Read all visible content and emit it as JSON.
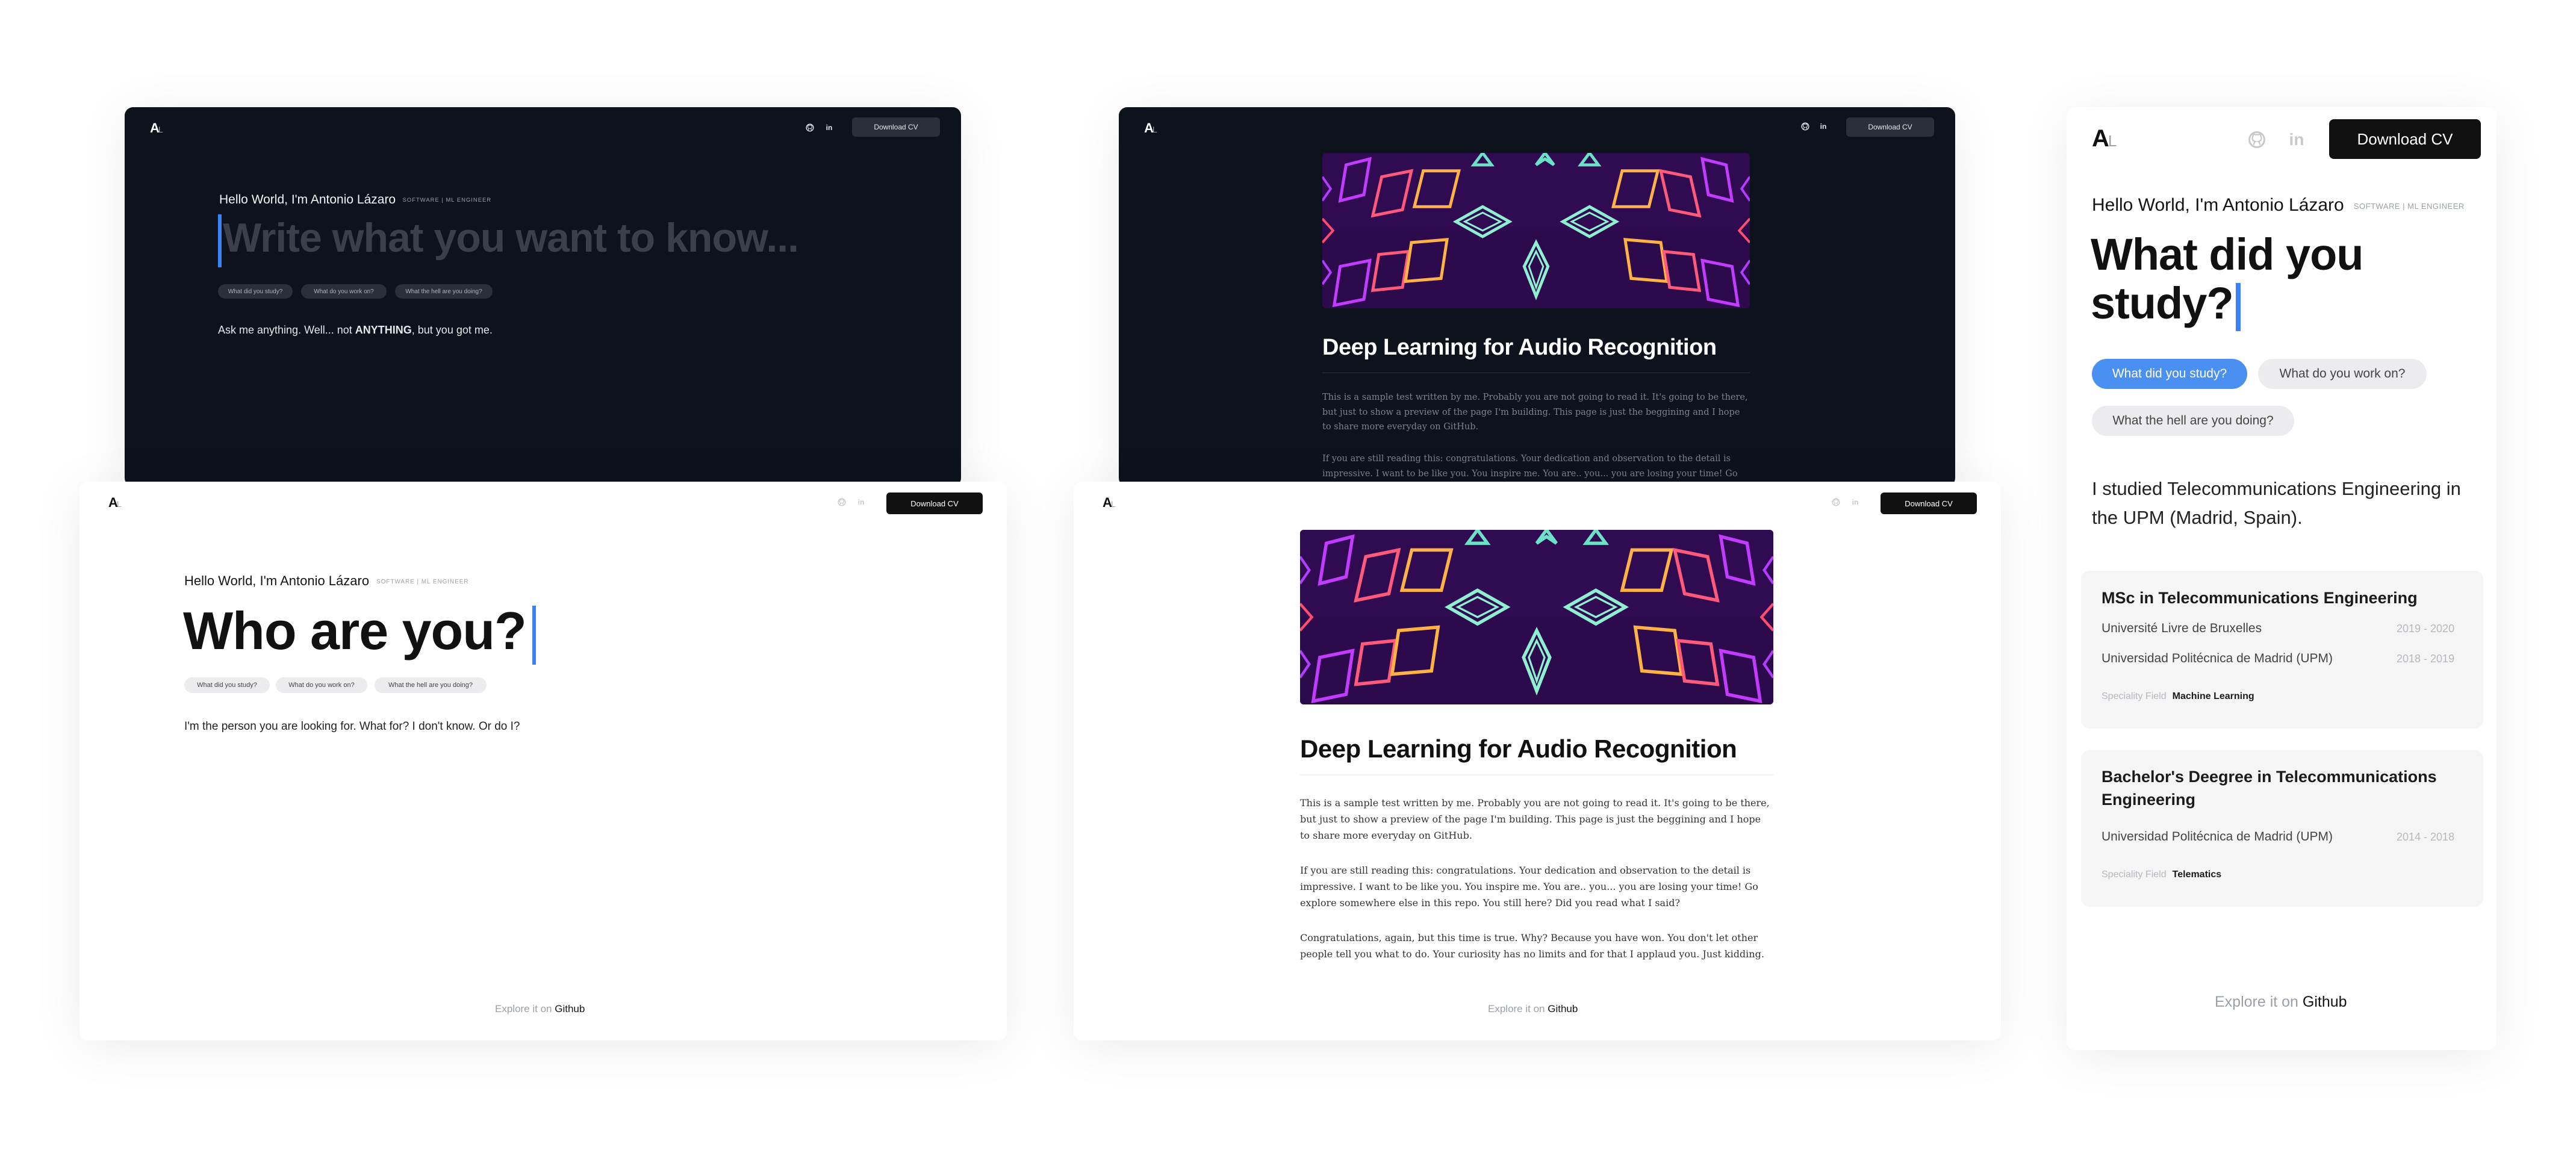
{
  "header": {
    "logo_a": "A",
    "logo_l": "L",
    "download_cv": "Download CV",
    "github_icon": "github-icon",
    "linkedin_icon": "linkedin-icon",
    "linkedin_label": "in"
  },
  "intro": {
    "hello": "Hello World, I'm",
    "name": "Antonio Lázaro",
    "role": "SOFTWARE | ML ENGINEER"
  },
  "questions": {
    "q1": "What did you study?",
    "q2": "What do you work on?",
    "q3": "What the hell are you doing?"
  },
  "screen1": {
    "placeholder": "Write what you want to know...",
    "answer_pre": "Ask me anything. Well... not ",
    "answer_strong": "ANYTHING",
    "answer_post": ", but you got me."
  },
  "screen2": {
    "headline": "Who are you?",
    "answer": "I'm the person you are looking for. What for? I don't know. Or do I?"
  },
  "article": {
    "title": "Deep Learning for Audio Recognition",
    "p1": "This is a sample test written by me. Probably you are not going to read it. It's going to be there, but just to show a preview of the page I'm building. This page is just the beggining and I hope to share more everyday on GitHub.",
    "p2": "If you are still reading this: congratulations. Your dedication and observation to the detail is impressive. I want to be like you. You inspire me. You are.. you... you are losing your time! Go explore somewhere else in this repo. You still here? Did you read what I said?",
    "p3": "Congratulations, again, but this time is true. Why? Because you have won. You don't let other people tell you what to do. Your curiosity has no limits and for that I applaud you. Just kidding."
  },
  "mobile": {
    "headline_line1": "What did you",
    "headline_line2": "study?",
    "answer": "I studied Telecommunications Engineering in the UPM (Madrid, Spain).",
    "edu": [
      {
        "degree": "MSc in Telecommunications Engineering",
        "schools": [
          {
            "name": "Université Livre de Bruxelles",
            "years": "2019 - 2020"
          },
          {
            "name": "Universidad Politécnica de Madrid (UPM)",
            "years": "2018 - 2019"
          }
        ],
        "field_label": "Speciality Field",
        "field": "Machine Learning"
      },
      {
        "degree": "Bachelor's Deegree in Telecommunications Engineering",
        "schools": [
          {
            "name": "Universidad Politécnica de Madrid (UPM)",
            "years": "2014 - 2018"
          }
        ],
        "field_label": "Speciality Field",
        "field": "Telematics"
      }
    ]
  },
  "footer": {
    "explore": "Explore it on",
    "github": "Github"
  },
  "colors": {
    "dark_bg": "#0e121c",
    "accent_blue": "#3b82f6",
    "chip_blue": "#4a90f0",
    "banner_purple": "#2a0a4a"
  }
}
